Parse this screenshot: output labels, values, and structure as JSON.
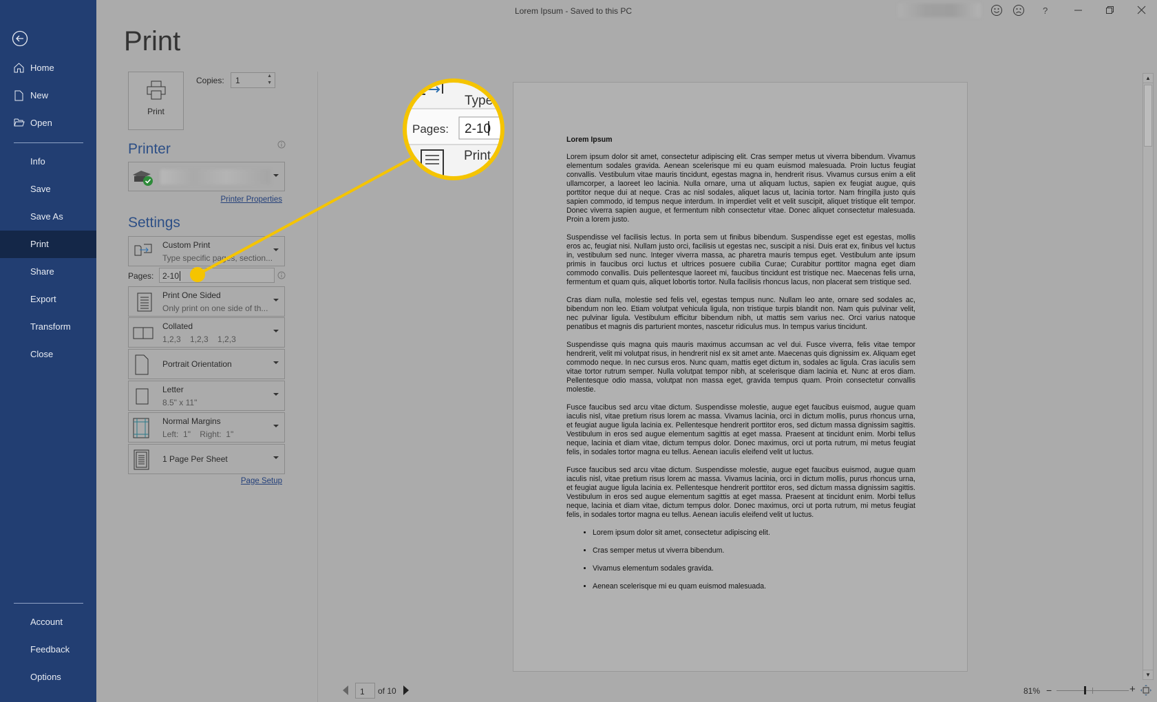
{
  "window": {
    "title": "Lorem Ipsum  -  Saved to this PC"
  },
  "titlebar_icons": [
    "smiley-icon",
    "frown-icon",
    "help-icon",
    "minimize-icon",
    "restore-icon",
    "close-icon"
  ],
  "titlebar_labels": {
    "help": "?"
  },
  "sidebar": {
    "items": [
      {
        "label": "Home",
        "icon": "home-icon"
      },
      {
        "label": "New",
        "icon": "new-document-icon"
      },
      {
        "label": "Open",
        "icon": "folder-open-icon"
      },
      {
        "label": "Info"
      },
      {
        "label": "Save"
      },
      {
        "label": "Save As"
      },
      {
        "label": "Print",
        "selected": true
      },
      {
        "label": "Share"
      },
      {
        "label": "Export"
      },
      {
        "label": "Transform"
      },
      {
        "label": "Close"
      },
      {
        "label": "Account"
      },
      {
        "label": "Feedback"
      },
      {
        "label": "Options"
      }
    ]
  },
  "print": {
    "title": "Print",
    "button": "Print",
    "copies_label": "Copies:",
    "copies": "1",
    "printer_heading": "Printer",
    "printer_properties": "Printer Properties",
    "settings_heading": "Settings",
    "settings": [
      {
        "l1": "Custom Print",
        "l2": "Type specific pages, section..."
      },
      {
        "l1": "Print One Sided",
        "l2": "Only print on one side of th..."
      },
      {
        "l1": "Collated",
        "l2": "1,2,3    1,2,3    1,2,3"
      },
      {
        "l1": "Portrait Orientation"
      },
      {
        "l1": "Letter",
        "l2": "8.5\" x 11\""
      },
      {
        "l1": "Normal Margins",
        "l2": "Left:  1\"    Right:  1\""
      },
      {
        "l1": "1 Page Per Sheet"
      }
    ],
    "pages_label": "Pages:",
    "pages_value": "2-10",
    "page_setup": "Page Setup"
  },
  "callout": {
    "type_text": "Type",
    "pages_label": "Pages:",
    "pages_value": "2-10",
    "print_text": "Print",
    "color": "#f5c400"
  },
  "document": {
    "title": "Lorem Ipsum",
    "paragraphs": [
      "Lorem ipsum dolor sit amet, consectetur adipiscing elit. Cras semper metus ut viverra bibendum. Vivamus elementum sodales gravida. Aenean scelerisque mi eu quam euismod malesuada. Proin luctus feugiat convallis. Vestibulum vitae mauris tincidunt, egestas magna in, hendrerit risus. Vivamus cursus enim a elit ullamcorper, a laoreet leo lacinia. Nulla ornare, urna ut aliquam luctus, sapien ex feugiat augue, quis porttitor neque dui at neque. Cras ac nisl sodales, aliquet lacus ut, lacinia tortor. Nam fringilla justo quis sapien commodo, id tempus neque interdum. In imperdiet velit et velit suscipit, aliquet tristique elit tempor. Donec viverra sapien augue, et fermentum nibh consectetur vitae. Donec aliquet consectetur malesuada. Proin a lorem justo.",
      "Suspendisse vel facilisis lectus. In porta sem ut finibus bibendum. Suspendisse eget est egestas, mollis eros ac, feugiat nisi. Nullam justo orci, facilisis ut egestas nec, suscipit a nisi. Duis erat ex, finibus vel luctus in, vestibulum sed nunc. Integer viverra massa, ac pharetra mauris tempus eget. Vestibulum ante ipsum primis in faucibus orci luctus et ultrices posuere cubilia Curae; Curabitur porttitor magna eget diam commodo convallis. Duis pellentesque laoreet mi, faucibus tincidunt est tristique nec. Maecenas felis urna, fermentum et quam quis, aliquet lobortis tortor. Nulla facilisis rhoncus lacus, non placerat sem tristique sed.",
      "Cras diam nulla, molestie sed felis vel, egestas tempus nunc. Nullam leo ante, ornare sed sodales ac, bibendum non leo. Etiam volutpat vehicula ligula, non tristique turpis blandit non. Nam quis pulvinar velit, nec pulvinar ligula. Vestibulum efficitur bibendum nibh, ut mattis sem varius nec. Orci varius natoque penatibus et magnis dis parturient montes, nascetur ridiculus mus. In tempus varius tincidunt.",
      "Suspendisse quis magna quis mauris maximus accumsan ac vel dui. Fusce viverra, felis vitae tempor hendrerit, velit mi volutpat risus, in hendrerit nisl ex sit amet ante. Maecenas quis dignissim ex. Aliquam eget commodo neque. In nec cursus eros. Nunc quam, mattis eget dictum in, sodales ac ligula. Cras iaculis sem vitae tortor rutrum semper. Nulla volutpat tempor nibh, at scelerisque diam lacinia et. Nunc at eros diam. Pellentesque odio massa, volutpat non massa eget, gravida tempus quam. Proin consectetur convallis molestie.",
      "Fusce faucibus sed arcu vitae dictum. Suspendisse molestie, augue eget faucibus euismod, augue quam iaculis nisl, vitae pretium risus lorem ac massa. Vivamus lacinia, orci in dictum mollis, purus rhoncus urna, et feugiat augue ligula lacinia ex. Pellentesque hendrerit porttitor eros, sed dictum massa dignissim sagittis. Vestibulum in eros sed augue elementum sagittis at eget massa. Praesent at tincidunt enim. Morbi tellus neque, lacinia et diam vitae, dictum tempus dolor. Donec maximus, orci ut porta rutrum, mi metus feugiat felis, in sodales tortor magna eu tellus. Aenean iaculis eleifend velit ut luctus.",
      "Fusce faucibus sed arcu vitae dictum. Suspendisse molestie, augue eget faucibus euismod, augue quam iaculis nisl, vitae pretium risus lorem ac massa. Vivamus lacinia, orci in dictum mollis, purus rhoncus urna, et feugiat augue ligula lacinia ex. Pellentesque hendrerit porttitor eros, sed dictum massa dignissim sagittis. Vestibulum in eros sed augue elementum sagittis at eget massa. Praesent at tincidunt enim. Morbi tellus neque, lacinia et diam vitae, dictum tempus dolor. Donec maximus, orci ut porta rutrum, mi metus feugiat felis, in sodales tortor magna eu tellus. Aenean iaculis eleifend velit ut luctus."
    ],
    "bullets": [
      "Lorem ipsum dolor sit amet, consectetur adipiscing elit.",
      "Cras semper metus ut viverra bibendum.",
      "Vivamus elementum sodales gravida.",
      "Aenean scelerisque mi eu quam euismod malesuada."
    ]
  },
  "navigation": {
    "current_page": "1",
    "of_label": "of 10"
  },
  "zoom": {
    "label": "81%",
    "value": 81
  }
}
